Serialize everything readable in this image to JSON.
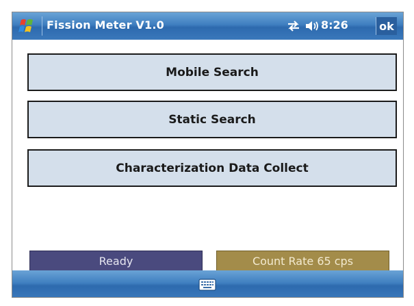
{
  "titlebar": {
    "app_title": "Fission Meter V1.0",
    "time": "8:26",
    "ok_label": "ok",
    "icons": [
      "windows-start-icon",
      "connectivity-icon",
      "volume-icon"
    ]
  },
  "menu": {
    "buttons": [
      {
        "label": "Mobile Search"
      },
      {
        "label": "Static Search"
      },
      {
        "label": "Characterization Data Collect"
      }
    ]
  },
  "status": {
    "state": "Ready",
    "count_rate": "Count Rate 65 cps"
  },
  "menubar": {
    "icons": [
      "keyboard-icon"
    ]
  },
  "colors": {
    "titlebar_blue": "#3f7fc0",
    "button_fill": "#d4dfeb",
    "status_ready": "#4a4a7e",
    "status_count": "#a38c4a"
  }
}
